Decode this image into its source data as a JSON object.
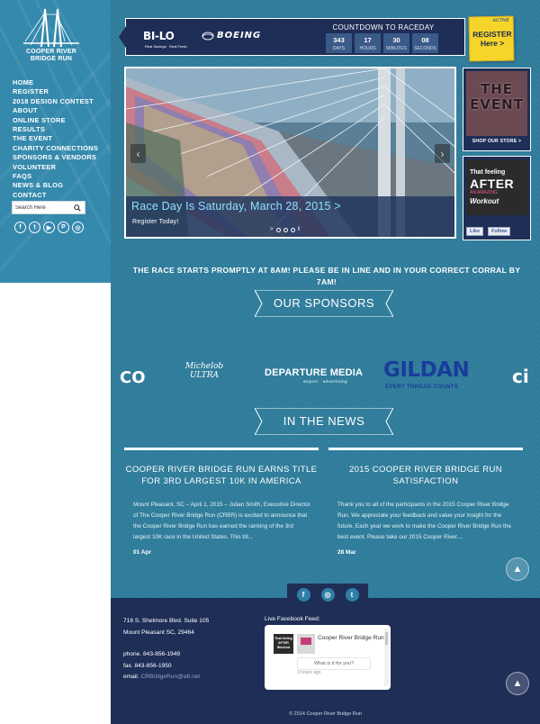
{
  "sidebar": {
    "logo_text": [
      "COOPER RIVER",
      "BRIDGE RUN"
    ],
    "nav": [
      "HOME",
      "REGISTER",
      "2018 DESIGN CONTEST",
      "ABOUT",
      "ONLINE STORE",
      "RESULTS",
      "THE EVENT",
      "CHARITY CONNECTIONS",
      "SPONSORS & VENDORS",
      "VOLUNTEER",
      "FAQS",
      "NEWS & BLOG",
      "CONTACT"
    ],
    "search_placeholder": "Search Here",
    "social_icons": [
      "facebook-icon",
      "twitter-icon",
      "youtube-icon",
      "pinterest-icon",
      "instagram-icon"
    ]
  },
  "banner": {
    "bilo": "BI-LO",
    "bilo_tag": "Real Savings · Real Fresh",
    "boeing": "BOEING",
    "countdown_title": "COUNTDOWN TO RACEDAY",
    "countdown": [
      {
        "value": "343",
        "label": "DAYS"
      },
      {
        "value": "17",
        "label": "HOURS"
      },
      {
        "value": "30",
        "label": "MINUTES"
      },
      {
        "value": "08",
        "label": "SECONDS"
      }
    ],
    "register_brand": "ACTIVE",
    "register_label": [
      "REGISTER",
      "Here >"
    ]
  },
  "slider": {
    "title": "Race Day Is Saturday, March 28, 2015 >",
    "subtitle": "Register Today!",
    "pager": ">"
  },
  "ads": {
    "store_image_text": [
      "THE",
      "EVENT"
    ],
    "store_label": "SHOP OUR STORE >",
    "fb_image_lines": [
      "That feeling",
      "AFTER",
      "AN AMAZING",
      "Workout"
    ],
    "like_label": "Like",
    "follow_label": "Follow"
  },
  "notice": "THE RACE STARTS PROMPTLY AT 8AM! PLEASE BE IN LINE AND IN YOUR CORRECT CORRAL BY 7AM!",
  "sponsors": {
    "heading": "OUR SPONSORS",
    "logos": [
      "CO",
      "Michelob ULTRA",
      "DEPARTURE MEDIA",
      "airport · advertising",
      "GILDAN",
      "EVERY THREAD COUNTS",
      "ci"
    ]
  },
  "news": {
    "heading": "IN THE NEWS",
    "items": [
      {
        "title": "COOPER RIVER BRIDGE RUN EARNS TITLE FOR 3RD LARGEST 10K IN AMERICA",
        "body": "Mount Pleasant, SC – April 1, 2015 – Julian Smith, Executive Director of The Cooper River Bridge Run (CRBR) is excited to announce that the Cooper River Bridge Run has earned the ranking of the 3rd largest 10K race in the United States. This titl...",
        "date": "01 Apr"
      },
      {
        "title": "2015 COOPER RIVER BRIDGE RUN SATISFACTION",
        "body": "Thank you to all of the participants in the 2015 Cooper River Bridge Run. We appreciate your feedback and value your insight for the future. Each year we work to make the Cooper River Bridge Run the best event. Please take our 2015 Cooper River....",
        "date": "28 Mar"
      }
    ]
  },
  "footer": {
    "address": [
      "716 S. Shelmore Blvd. Suite 105",
      "Mount Pleasant SC, 29464"
    ],
    "phone": "phone. 843-856-1949",
    "fax": "fax. 843-856-1950",
    "email_label": "email.",
    "email": "CRBridgeRun@att.net",
    "feed_label": "Live Facebook Feed:",
    "feed_name": "Cooper River Bridge Run",
    "feed_prompt": "What is it for you?",
    "feed_time": "3 hours ago",
    "copyright": "© 2014 Cooper River Bridge Run"
  }
}
